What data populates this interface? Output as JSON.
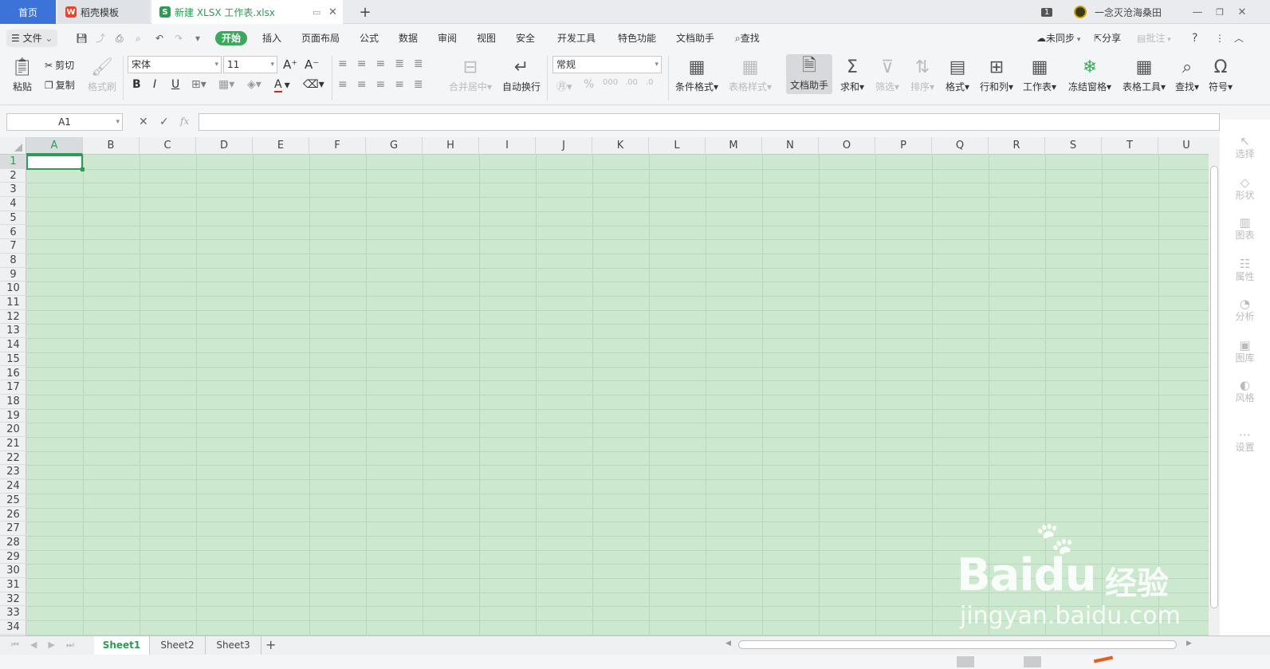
{
  "titlebar": {
    "tabs": [
      {
        "label": "首页"
      },
      {
        "label": "稻壳模板"
      },
      {
        "label": "新建 XLSX 工作表.xlsx"
      }
    ],
    "new_tab": "+",
    "badge": "1",
    "user": "一念灭沧海桑田"
  },
  "menu": {
    "file": "文件",
    "items": [
      "开始",
      "插入",
      "页面布局",
      "公式",
      "数据",
      "审阅",
      "视图",
      "安全",
      "开发工具",
      "特色功能",
      "文档助手",
      "查找"
    ],
    "sync": "未同步",
    "share": "分享",
    "comment": "批注",
    "help": "?"
  },
  "ribbon": {
    "paste": "粘贴",
    "cut": "剪切",
    "copy": "复制",
    "format_painter": "格式刷",
    "font_name": "宋体",
    "font_size": "11",
    "merge": "合并居中",
    "wrap": "自动换行",
    "number_format": "常规",
    "cond_format": "条件格式",
    "table_style": "表格样式",
    "doc_helper": "文档助手",
    "sum": "求和",
    "filter": "筛选",
    "sort": "排序",
    "format": "格式",
    "rowcol": "行和列",
    "worksheet": "工作表",
    "freeze": "冻结窗格",
    "table_tools": "表格工具",
    "find": "查找",
    "symbol": "符号"
  },
  "formula_bar": {
    "name_box": "A1",
    "fx": "fx",
    "content": ""
  },
  "sheet": {
    "columns": [
      "A",
      "B",
      "C",
      "D",
      "E",
      "F",
      "G",
      "H",
      "I",
      "J",
      "K",
      "L",
      "M",
      "N",
      "O",
      "P",
      "Q",
      "R",
      "S",
      "T",
      "U"
    ],
    "rows": [
      "1",
      "2",
      "3",
      "4",
      "5",
      "6",
      "7",
      "8",
      "9",
      "10",
      "11",
      "12",
      "13",
      "14",
      "15",
      "16",
      "17",
      "18",
      "19",
      "20",
      "21",
      "22",
      "23",
      "24",
      "25",
      "26",
      "27",
      "28",
      "29",
      "30",
      "31",
      "32",
      "33",
      "34"
    ],
    "active_cell": "A1",
    "cell_background": "#cce8cf"
  },
  "side_panel": [
    "选择",
    "形状",
    "图表",
    "属性",
    "分析",
    "图库",
    "风格",
    "设置"
  ],
  "sheet_tabs": [
    "Sheet1",
    "Sheet2",
    "Sheet3"
  ],
  "add_sheet": "+",
  "watermark": {
    "brand": "Baidu",
    "brand_cn": "经验",
    "url": "jingyan.baidu.com"
  },
  "colors": {
    "accent": "#3aaa5a",
    "home_tab": "#3b73d9"
  }
}
